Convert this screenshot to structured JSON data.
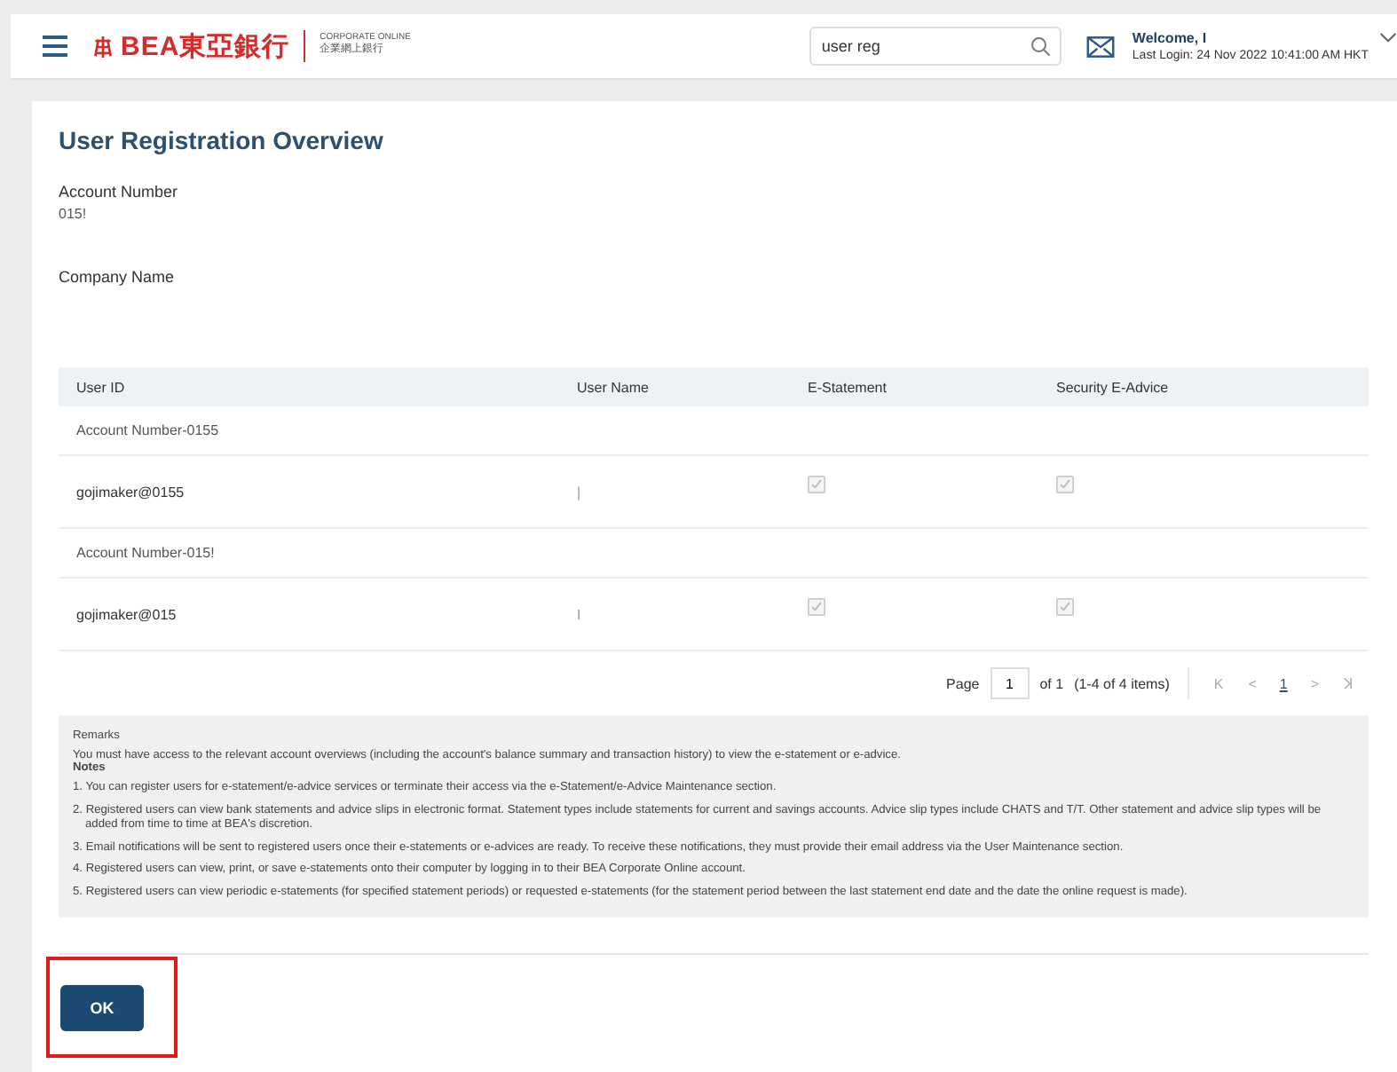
{
  "header": {
    "logo_text": "BEA東亞銀行",
    "product_en": "CORPORATE ONLINE",
    "product_zh": "企業網上銀行",
    "search": {
      "value": "user reg"
    },
    "welcome": "Welcome, I",
    "last_login": "Last Login: 24 Nov 2022 10:41:00 AM HKT"
  },
  "page": {
    "title": "User Registration Overview",
    "fields": [
      {
        "label": "Account Number",
        "value": "015!"
      },
      {
        "label": "Company Name"
      }
    ]
  },
  "table": {
    "columns": [
      "User ID",
      "User Name",
      "E-Statement",
      "Security E-Advice"
    ],
    "rows": [
      {
        "kind": "group",
        "label": "Account Number-0155"
      },
      {
        "kind": "user",
        "user_id": "gojimaker@0155",
        "user_name": "|",
        "e_statement": {
          "checked": true,
          "disabled": true
        },
        "security_e_advice": {
          "checked": true,
          "disabled": true
        }
      },
      {
        "kind": "group",
        "label": "Account Number-015!"
      },
      {
        "kind": "user",
        "user_id": "gojimaker@015",
        "user_name": "I",
        "e_statement": {
          "checked": true,
          "disabled": true
        },
        "security_e_advice": {
          "checked": true,
          "disabled": true
        }
      }
    ]
  },
  "pager": {
    "label": "Page",
    "page": "1",
    "of": "of 1",
    "range": "(1-4 of 4 items)",
    "first": "K",
    "prev": "<",
    "pages": [
      {
        "label": "1",
        "selected": true
      }
    ],
    "next": ">",
    "last": "ꓘ"
  },
  "remarks": {
    "title": "Remarks",
    "intro": "You must have access to the relevant account overviews (including the account's balance summary and transaction history) to view the e-statement or e-advice.",
    "notes_title": "Notes",
    "notes": [
      "1. You can register users for e-statement/e-advice services or terminate their access via the e-Statement/e-Advice Maintenance section.",
      "2. Registered users can view bank statements and advice slips in electronic format. Statement types include statements for current and savings accounts. Advice slip types include CHATS and T/T. Other statement and advice slip types will be added from time to time at BEA's discretion.",
      "3. Email notifications will be sent to registered users once their e-statements or e-advices are ready. To receive these notifications, they must provide their email address via the User Maintenance section.",
      "4. Registered users can view, print, or save e-statements onto their computer by logging in to their BEA Corporate Online account.",
      "5. Registered users can view periodic e-statements (for specified statement periods) or requested e-statements (for the statement period between the last statement end date and the date the online request is made)."
    ]
  },
  "ok_button": {
    "label": "OK",
    "highlighted": true
  }
}
